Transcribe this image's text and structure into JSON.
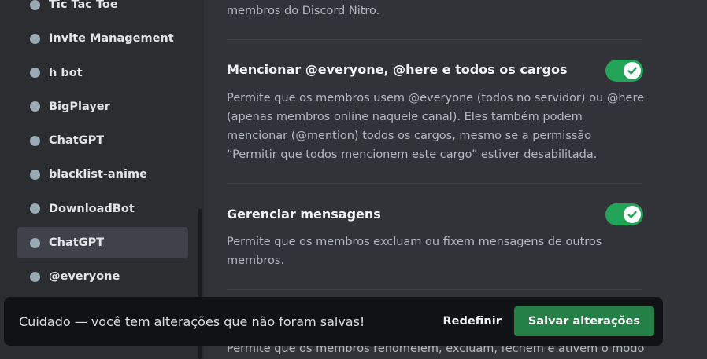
{
  "sidebar": {
    "roles": [
      {
        "label": "Tic Tac Toe"
      },
      {
        "label": "Invite Management"
      },
      {
        "label": "h bot"
      },
      {
        "label": "BigPlayer"
      },
      {
        "label": "ChatGPT"
      },
      {
        "label": "blacklist-anime"
      },
      {
        "label": "DownloadBot"
      },
      {
        "label": "ChatGPT",
        "selected": true
      },
      {
        "label": "@everyone"
      }
    ]
  },
  "main": {
    "top_description": "membros do Discord Nitro.",
    "permissions": [
      {
        "title": "Mencionar @everyone, @here e todos os cargos",
        "description": "Permite que os membros usem @everyone (todos no servidor) ou @here (apenas membros online naquele canal). Eles também podem mencionar (@mention) todos os cargos, mesmo se a permissão “Permitir que todos mencionem este cargo” estiver desabilitada.",
        "enabled": true
      },
      {
        "title": "Gerenciar mensagens",
        "description": "Permite que os membros excluam ou fixem mensagens de outros membros.",
        "enabled": true
      }
    ],
    "bottom_description": "Permite que os membros renomeiem, excluam, fechem e ativem o modo"
  },
  "notice": {
    "text": "Cuidado — você tem alterações que não foram salvas!",
    "reset_label": "Redefinir",
    "save_label": "Salvar alterações"
  },
  "colors": {
    "toggle_on": "#23a559",
    "save_button": "#248046",
    "role_dot": "#99aab5"
  },
  "icons": {
    "toggle_check": "check-icon",
    "role_color": "role-dot-icon"
  }
}
